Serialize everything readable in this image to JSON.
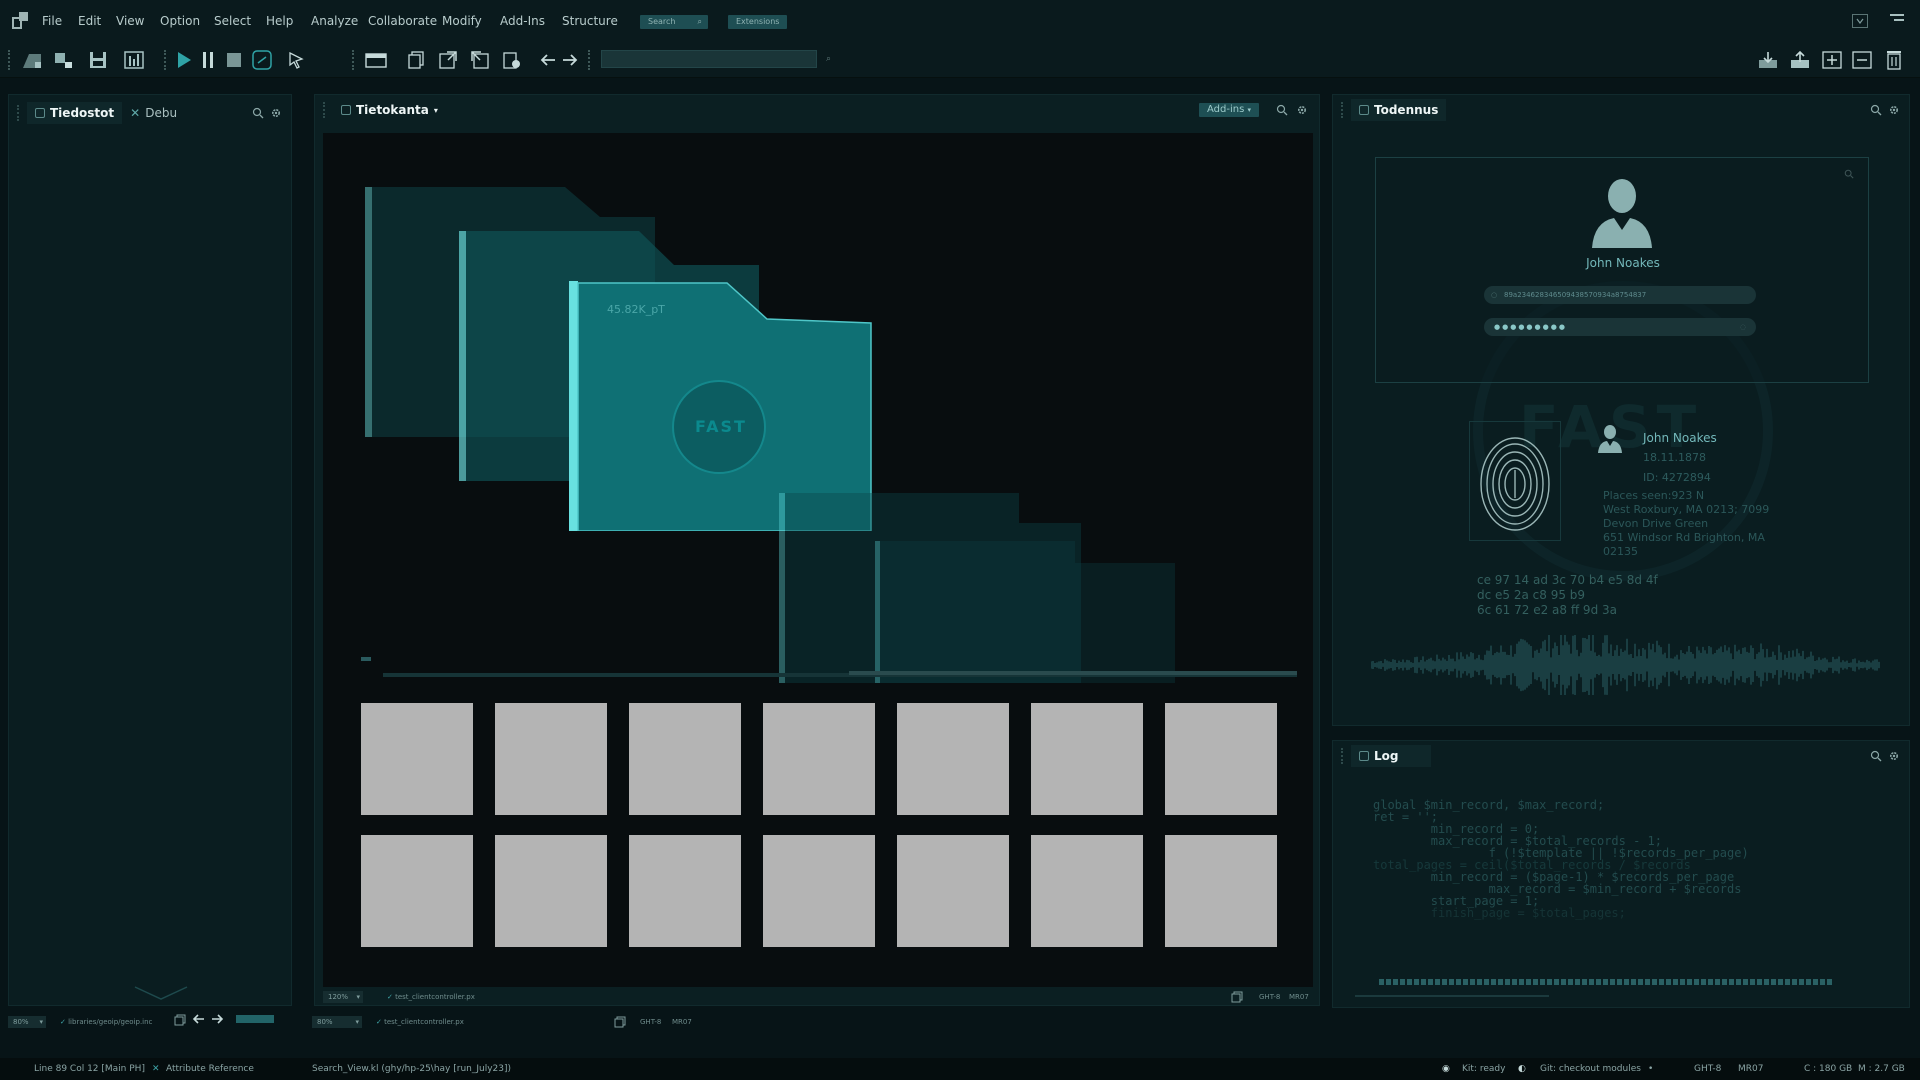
{
  "menu": {
    "items": [
      "File",
      "Edit",
      "View",
      "Option",
      "Select",
      "Help",
      "Analyze",
      "Collaborate",
      "Modify",
      "Add-Ins",
      "Structure"
    ],
    "search_label": "Search",
    "extensions_label": "Extensions"
  },
  "left_panel": {
    "tabs": [
      "Tiedostot",
      "Debu"
    ],
    "footer": {
      "zoom": "80%",
      "path": "libraries/geoip/geoip.inc"
    }
  },
  "main_panel": {
    "tab": "Tietokanta",
    "addins_label": "Add-ins",
    "folder_label": "45.82K_pT",
    "folder_logo": "FAST",
    "inner_footer": {
      "zoom": "120%",
      "file": "test_clientcontroller.px",
      "code1": "GHT-8",
      "code2": "MR07"
    },
    "outer_footer": {
      "zoom": "80%",
      "file": "test_clientcontroller.px",
      "code1": "GHT-8",
      "code2": "MR07"
    }
  },
  "auth_panel": {
    "tab": "Todennus",
    "user_name": "John Noakes",
    "token_value": "89a234628346509438570934a8754837",
    "password_mask": "●●●●●●●●●",
    "watermark": "FAST",
    "profile": {
      "name": "John Noakes",
      "dob": "18.11.1878",
      "id": "ID: 4272894",
      "places_line": "Places seen:923 N",
      "address1": "West Roxbury, MA 0213; 7099",
      "address2": "Devon Drive Green",
      "address3": "651 Windsor Rd Brighton, MA",
      "address4": "02135"
    },
    "hex_lines": [
      "ce 97 14 ad 3c 70 b4 e5 8d 4f",
      "dc e5 2a c8 95 b9",
      "6c 61 72 e2 a8 ff 9d 3a"
    ]
  },
  "log_panel": {
    "tab": "Log",
    "code_lines": [
      "global $min_record, $max_record;",
      "ret = '';",
      "        min_record = 0;",
      "        max_record = $total_records - 1;",
      "                f (!$template || !$records_per_page)",
      "total_pages = ceil($total_records / $records",
      "        min_record = ($page-1) * $records_per_page",
      "                max_record = $min_record + $records",
      "        start_page = 1;",
      "        finish_page = $total_pages;"
    ]
  },
  "statusbar": {
    "position": "Line 89 Col 12 [Main PH]",
    "attribute": "Attribute Reference",
    "search_view": "Search_View.kl (ghy/hp-25\\hay [run_July23])",
    "kit": "Kit: ready",
    "git": "Git: checkout modules",
    "ght": "GHT-8",
    "mr": "MR07",
    "disk_c": "C : 180 GB",
    "disk_m": "M : 2.7 GB"
  },
  "colors": {
    "background": "#071417",
    "panel": "#0a1d20",
    "accent": "#1e8b90",
    "folder_face": "#0f6e72",
    "folder_edge": "#5ed8da",
    "tile": "#b4b4b4"
  }
}
